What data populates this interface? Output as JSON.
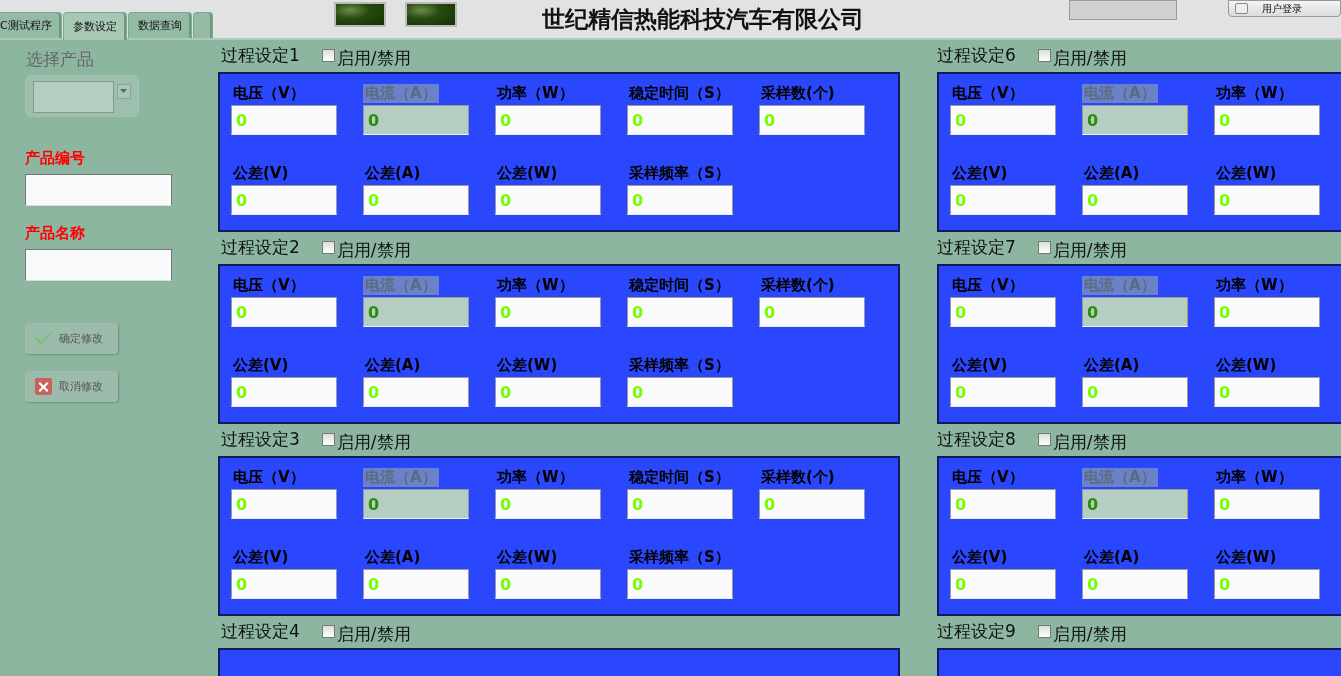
{
  "header": {
    "tabs": [
      {
        "label": "C测试程序",
        "selected": false
      },
      {
        "label": "参数设定",
        "selected": true
      },
      {
        "label": "数据查询",
        "selected": false
      },
      {
        "selected": false
      }
    ],
    "indicators": [
      {
        "on": false
      },
      {
        "on": false
      }
    ],
    "title": "世纪精信热能科技汽车有限公司",
    "login_button": "用户登录"
  },
  "sidebar": {
    "product_select": {
      "label": "选择产品",
      "disabled": true
    },
    "product_code": {
      "label": "产品编号"
    },
    "product_name": {
      "label": "产品名称"
    },
    "buttons": [
      {
        "kind": "confirm",
        "label": "确定修改",
        "disabled": true
      },
      {
        "kind": "cancel",
        "label": "取消修改",
        "disabled": true
      }
    ]
  },
  "groups_left": [
    {
      "title": "过程设定1",
      "toggle": "启用/禁用",
      "enabled": false,
      "fields": [
        {
          "label": "电压（V）",
          "value": "0",
          "disabled": false
        },
        {
          "label": "电流（A）",
          "value": "0",
          "disabled": true
        },
        {
          "label": "功率（W）",
          "value": "0",
          "disabled": false
        },
        {
          "label": "稳定时间（S）",
          "value": "0",
          "disabled": false
        },
        {
          "label": "采样数(个)",
          "value": "0",
          "disabled": false
        },
        {
          "label": "公差(V)",
          "value": "0",
          "disabled": false
        },
        {
          "label": "公差(A)",
          "value": "0",
          "disabled": false
        },
        {
          "label": "公差(W)",
          "value": "0",
          "disabled": false
        },
        {
          "label": "采样频率（S）",
          "value": "0",
          "disabled": false
        }
      ]
    },
    {
      "title": "过程设定2",
      "toggle": "启用/禁用",
      "enabled": false,
      "fields": [
        {
          "label": "电压（V）",
          "value": "0",
          "disabled": false
        },
        {
          "label": "电流（A）",
          "value": "0",
          "disabled": true
        },
        {
          "label": "功率（W）",
          "value": "0",
          "disabled": false
        },
        {
          "label": "稳定时间（S）",
          "value": "0",
          "disabled": false
        },
        {
          "label": "采样数(个)",
          "value": "0",
          "disabled": false
        },
        {
          "label": "公差(V)",
          "value": "0",
          "disabled": false
        },
        {
          "label": "公差(A)",
          "value": "0",
          "disabled": false
        },
        {
          "label": "公差(W)",
          "value": "0",
          "disabled": false
        },
        {
          "label": "采样频率（S）",
          "value": "0",
          "disabled": false
        }
      ]
    },
    {
      "title": "过程设定3",
      "toggle": "启用/禁用",
      "enabled": false,
      "fields": [
        {
          "label": "电压（V）",
          "value": "0",
          "disabled": false
        },
        {
          "label": "电流（A）",
          "value": "0",
          "disabled": true
        },
        {
          "label": "功率（W）",
          "value": "0",
          "disabled": false
        },
        {
          "label": "稳定时间（S）",
          "value": "0",
          "disabled": false
        },
        {
          "label": "采样数(个)",
          "value": "0",
          "disabled": false
        },
        {
          "label": "公差(V)",
          "value": "0",
          "disabled": false
        },
        {
          "label": "公差(A)",
          "value": "0",
          "disabled": false
        },
        {
          "label": "公差(W)",
          "value": "0",
          "disabled": false
        },
        {
          "label": "采样频率（S）",
          "value": "0",
          "disabled": false
        }
      ]
    },
    {
      "title": "过程设定4",
      "toggle": "启用/禁用",
      "enabled": false
    }
  ],
  "groups_right": [
    {
      "title": "过程设定6",
      "toggle": "启用/禁用",
      "enabled": false,
      "fields": [
        {
          "label": "电压（V）",
          "value": "0",
          "disabled": false
        },
        {
          "label": "电流（A）",
          "value": "0",
          "disabled": true
        },
        {
          "label": "功率（W）",
          "value": "0",
          "disabled": false
        },
        {
          "label": "公差(V)",
          "value": "0",
          "disabled": false
        },
        {
          "label": "公差(A)",
          "value": "0",
          "disabled": false
        },
        {
          "label": "公差(W)",
          "value": "0",
          "disabled": false
        }
      ]
    },
    {
      "title": "过程设定7",
      "toggle": "启用/禁用",
      "enabled": false,
      "fields": [
        {
          "label": "电压（V）",
          "value": "0",
          "disabled": false
        },
        {
          "label": "电流（A）",
          "value": "0",
          "disabled": true
        },
        {
          "label": "功率（W）",
          "value": "0",
          "disabled": false
        },
        {
          "label": "公差(V)",
          "value": "0",
          "disabled": false
        },
        {
          "label": "公差(A)",
          "value": "0",
          "disabled": false
        },
        {
          "label": "公差(W)",
          "value": "0",
          "disabled": false
        }
      ]
    },
    {
      "title": "过程设定8",
      "toggle": "启用/禁用",
      "enabled": false,
      "fields": [
        {
          "label": "电压（V）",
          "value": "0",
          "disabled": false
        },
        {
          "label": "电流（A）",
          "value": "0",
          "disabled": true
        },
        {
          "label": "功率（W）",
          "value": "0",
          "disabled": false
        },
        {
          "label": "公差(V)",
          "value": "0",
          "disabled": false
        },
        {
          "label": "公差(A)",
          "value": "0",
          "disabled": false
        },
        {
          "label": "公差(W)",
          "value": "0",
          "disabled": false
        }
      ]
    },
    {
      "title": "过程设定9",
      "toggle": "启用/禁用",
      "enabled": false
    }
  ]
}
